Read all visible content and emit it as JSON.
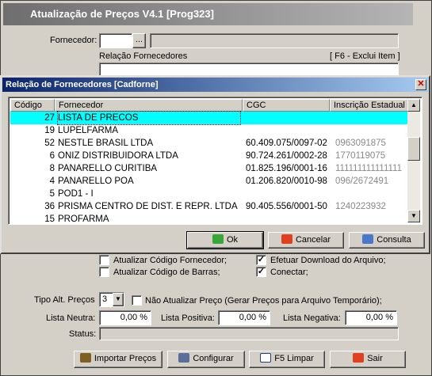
{
  "main": {
    "title": "Atualização de Preços V4.1 [Prog323]",
    "fornecedor_label": "Fornecedor:",
    "fornecedor_btn": "...",
    "relacao_label": "Relação Fornecedores",
    "relacao_hint": "[ F6 - Exclui Item ]",
    "chk_atualizar_codigo_fornecedor": "Atualizar Código Fornecedor;",
    "chk_atualizar_codigo_barras": "Atualizar Código de Barras;",
    "chk_efetuar_download": "Efetuar Download do Arquivo;",
    "chk_conectar": "Conectar;",
    "tipo_alt_label": "Tipo Alt. Preços",
    "tipo_alt_value": "3",
    "nao_atualizar_label": "Não Atualizar Preço (Gerar Preços para Arquivo Temporário);",
    "lista_neutra_label": "Lista Neutra:",
    "lista_neutra_value": "0,00 %",
    "lista_positiva_label": "Lista Positiva:",
    "lista_positiva_value": "0,00 %",
    "lista_negativa_label": "Lista Negativa:",
    "lista_negativa_value": "0,00 %",
    "status_label": "Status:",
    "buttons": {
      "importar": "Importar Preços",
      "configurar": "Configurar",
      "limpar": "F5 Limpar",
      "sair": "Sair"
    }
  },
  "dialog": {
    "title": "Relação de Fornecedores [Cadforne]",
    "columns": [
      "Código",
      "Fornecedor",
      "CGC",
      "Inscrição Estadual"
    ],
    "rows": [
      {
        "codigo": "27",
        "fornecedor": "LISTA DE PRECOS",
        "cgc": "",
        "ie": ""
      },
      {
        "codigo": "19",
        "fornecedor": "LUPELFARMA",
        "cgc": "",
        "ie": ""
      },
      {
        "codigo": "52",
        "fornecedor": "NESTLE BRASIL LTDA",
        "cgc": "60.409.075/0097-02",
        "ie": "0963091875"
      },
      {
        "codigo": "6",
        "fornecedor": "ONIZ DISTRIBUIDORA LTDA",
        "cgc": "90.724.261/0002-28",
        "ie": "1770119075"
      },
      {
        "codigo": "8",
        "fornecedor": "PANARELLO CURITIBA",
        "cgc": "01.825.196/0001-16",
        "ie": "111111111111111"
      },
      {
        "codigo": "4",
        "fornecedor": "PANARELLO POA",
        "cgc": "01.206.820/0010-98",
        "ie": "096/2672491"
      },
      {
        "codigo": "5",
        "fornecedor": "POD1 - I",
        "cgc": "",
        "ie": ""
      },
      {
        "codigo": "36",
        "fornecedor": "PRISMA CENTRO DE DIST. E REPR. LTDA",
        "cgc": "90.405.556/0001-50",
        "ie": "1240223932"
      },
      {
        "codigo": "15",
        "fornecedor": "PROFARMA",
        "cgc": "",
        "ie": ""
      }
    ],
    "buttons": {
      "ok": "Ok",
      "cancelar": "Cancelar",
      "consulta": "Consulta"
    }
  },
  "colors": {
    "selection": "#00ffff",
    "title_active": "#0a246a",
    "title_inactive": "#7b7b7b"
  }
}
